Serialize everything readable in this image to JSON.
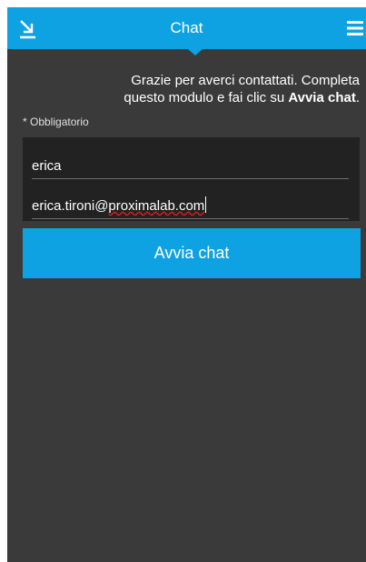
{
  "header": {
    "title": "Chat",
    "minimize_icon": "minimize-arrow-icon",
    "menu_icon": "hamburger-menu-icon",
    "accent_color": "#0fa2e3"
  },
  "intro": {
    "line1": "Grazie per averci contattati. Completa",
    "line2_prefix": "questo modulo e fai clic su ",
    "line2_bold": "Avvia chat",
    "line2_suffix": "."
  },
  "form": {
    "required_note": "* Obbligatorio",
    "name_value": "erica",
    "email_user": "erica.tironi@",
    "email_domain": "proximalab.com"
  },
  "actions": {
    "start_chat_label": "Avvia chat"
  }
}
